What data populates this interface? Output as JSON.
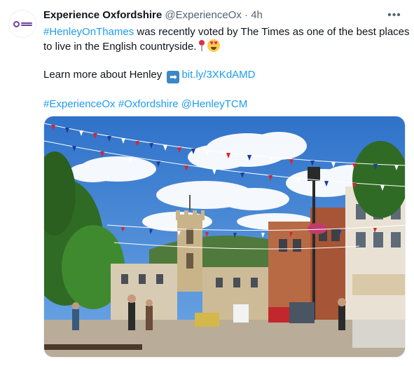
{
  "tweet": {
    "author_name": "Experience Oxfordshire",
    "author_handle": "@ExperienceOx",
    "separator": "·",
    "time": "4h",
    "more_icon": "more-horizontal-icon",
    "avatar_icon": "experience-oxfordshire-logo",
    "text": {
      "hashtag1": "#HenleyOnThames",
      "line1_rest": " was recently voted by The Times as one of the best places",
      "line2": "to live in the English countryside.",
      "emoji1": "round-pushpin-icon",
      "emoji2": "smiling-face-with-heart-eyes-icon",
      "learn_more": "Learn more about Henley",
      "arrow_icon": "right-arrow-icon",
      "link": "bit.ly/3XKdAMD",
      "tags": [
        "#ExperienceOx",
        "#Oxfordshire",
        "@HenleyTCM"
      ]
    },
    "media": {
      "type": "photo",
      "subject": "town-square-with-bunting"
    }
  },
  "colors": {
    "link": "#1d9bf0",
    "text": "#0f1419",
    "secondary": "#536471",
    "sky": "#3a83d6"
  }
}
